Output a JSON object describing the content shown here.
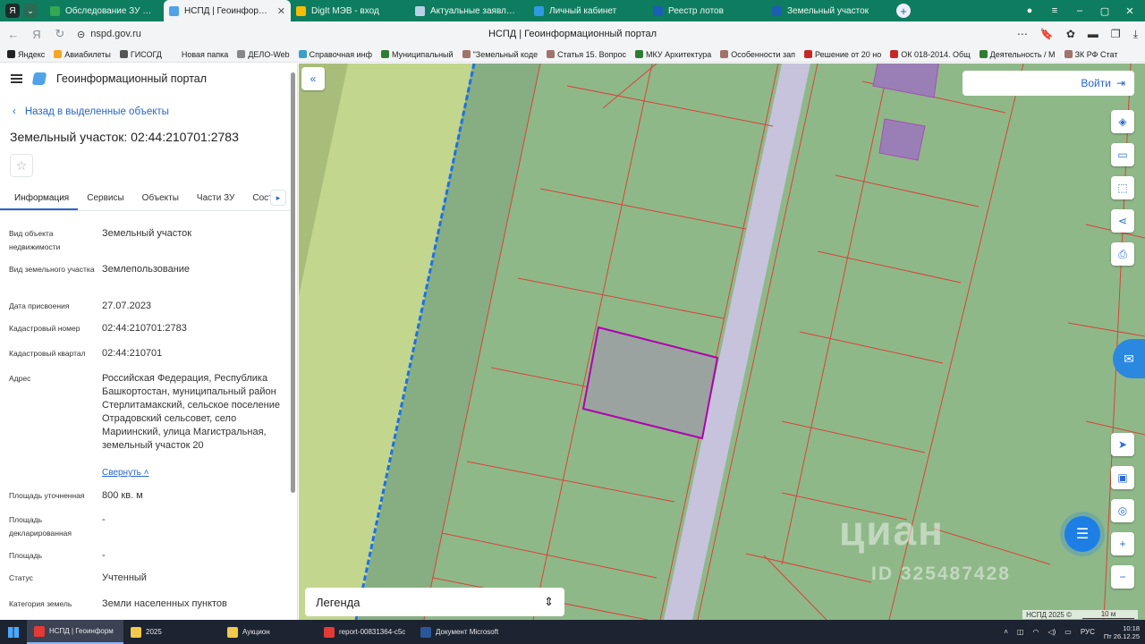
{
  "browser": {
    "tabs": [
      {
        "label": "Обследование ЗУ - Goog",
        "color": "#34a853"
      },
      {
        "label": "НСПД | Геоинформацио",
        "color": "#4fa3e6",
        "active": true
      },
      {
        "label": "DigIt МЭВ - вход",
        "color": "#fbbc04"
      },
      {
        "label": "Актуальные заявления",
        "color": "#b9d0e8"
      },
      {
        "label": "Личный кабинет",
        "color": "#2f9ae0"
      },
      {
        "label": "Реестр лотов",
        "color": "#1a5fb4"
      },
      {
        "label": "Земельный участок",
        "color": "#1a5fb4"
      }
    ],
    "url": "nspd.gov.ru",
    "page_title": "НСПД | Геоинформационный портал",
    "bookmarks": [
      {
        "label": "Яндекс",
        "color": "#222222"
      },
      {
        "label": "Авиабилеты",
        "color": "#f5a623"
      },
      {
        "label": "ГИСОГД",
        "color": "#555555"
      },
      {
        "label": "Новая папка",
        "color": "#f2f4f5"
      },
      {
        "label": "ДЕЛО-Web",
        "color": "#888888"
      },
      {
        "label": "Справочная инф",
        "color": "#3aa0c8"
      },
      {
        "label": "Муниципальный",
        "color": "#2e7d32"
      },
      {
        "label": "\"Земельный коде",
        "color": "#a0736b"
      },
      {
        "label": "Статья 15. Вопрос",
        "color": "#a0736b"
      },
      {
        "label": "МКУ Архитектура",
        "color": "#2e7d32"
      },
      {
        "label": "Особенности зап",
        "color": "#a0736b"
      },
      {
        "label": "Решение от 20 но",
        "color": "#c62828"
      },
      {
        "label": "ОК 018-2014. Общ",
        "color": "#c62828"
      },
      {
        "label": "Деятельность / М",
        "color": "#2e7d32"
      },
      {
        "label": "ЗК РФ Стат",
        "color": "#a0736b"
      }
    ]
  },
  "panel": {
    "app_title": "Геоинформационный портал",
    "back_label": "Назад в выделенные объекты",
    "title": "Земельный участок: 02:44:210701:2783",
    "tabs": [
      "Информация",
      "Сервисы",
      "Объекты",
      "Части ЗУ",
      "Соста"
    ],
    "fields": [
      {
        "label": "Вид объекта недвижимости",
        "value": "Земельный участок"
      },
      {
        "label": "Вид земельного участка",
        "value": "Землепользование"
      },
      {
        "label": "Дата присвоения",
        "value": "27.07.2023"
      },
      {
        "label": "Кадастровый номер",
        "value": "02:44:210701:2783"
      },
      {
        "label": "Кадастровый квартал",
        "value": "02:44:210701"
      },
      {
        "label": "Адрес",
        "value": "Российская Федерация, Республика Башкортостан, муниципальный район Стерлитамакский, сельское поселение Отрадовский сельсовет, село Мариинский, улица Магистральная, земельный участок 20"
      },
      {
        "label": "Площадь уточненная",
        "value": "800 кв. м"
      },
      {
        "label": "Площадь декларированная",
        "value": "-"
      },
      {
        "label": "Площадь",
        "value": "-"
      },
      {
        "label": "Статус",
        "value": "Учтенный"
      },
      {
        "label": "Категория земель",
        "value": "Земли населенных пунктов"
      }
    ],
    "collapse_label": "Свернуть"
  },
  "map": {
    "login_label": "Войти",
    "legend_label": "Легенда",
    "watermark": "циан",
    "watermark_id": "ID 325487428",
    "attribution": "НСПД 2025 ©",
    "scale_label": "10 м",
    "colors": {
      "parcel_fill": "#8fbb8b",
      "road": "#c7c3dc",
      "selected": "#b000b0",
      "boundary": "#d9423b"
    }
  },
  "taskbar": {
    "items": [
      {
        "label": "НСПД | Геоинформ",
        "color": "#e53935",
        "active": true
      },
      {
        "label": "2025",
        "color": "#f2c94c"
      },
      {
        "label": "Аукцион",
        "color": "#f2c94c"
      },
      {
        "label": "report-00831364-c5c",
        "color": "#e53935"
      },
      {
        "label": "Документ Microsoft",
        "color": "#2b579a"
      }
    ],
    "lang": "РУС",
    "time": "10:18",
    "date": "Пт 26.12.25"
  }
}
